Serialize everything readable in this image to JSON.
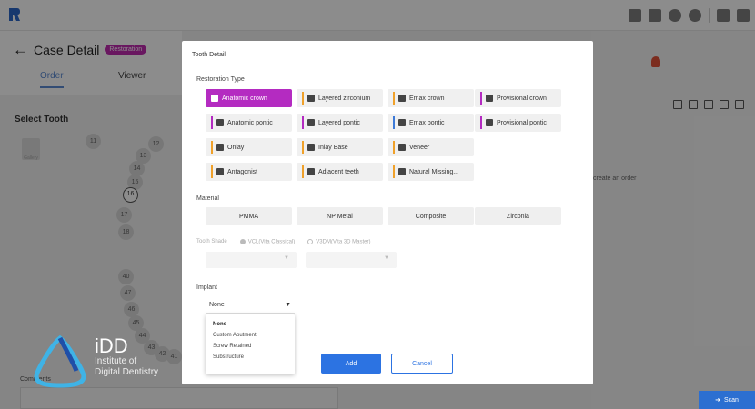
{
  "app": {
    "case_title": "Case Detail",
    "badge": "Restoration",
    "tabs": [
      "Order",
      "Viewer"
    ],
    "select_tooth": "Select Tooth",
    "gallery": "Gallery",
    "create_order_text": "create an order",
    "scan_label": "Scan",
    "comments_label": "Comments"
  },
  "teeth_upper": [
    "11",
    "12",
    "13",
    "14",
    "15",
    "16",
    "17",
    "18"
  ],
  "teeth_lower": [
    "40",
    "47",
    "46",
    "45",
    "44",
    "43",
    "42",
    "41"
  ],
  "watermark": {
    "big": "iDD",
    "line1": "Institute of",
    "line2": "Digital Dentistry"
  },
  "modal": {
    "title": "Tooth Detail",
    "restoration_label": "Restoration Type",
    "restoration_types": [
      "Anatomic crown",
      "Layered zirconium",
      "Emax crown",
      "Provisional crown",
      "Anatomic pontic",
      "Layered pontic",
      "Emax pontic",
      "Provisional pontic",
      "Onlay",
      "Inlay Base",
      "Veneer",
      "Antagonist",
      "Adjacent teeth",
      "Natural Missing..."
    ],
    "material_label": "Material",
    "materials": [
      "PMMA",
      "NP Metal",
      "Composite",
      "Zirconia"
    ],
    "shade_label": "Tooth Shade",
    "shade_options": [
      "VCL(Vita Classical)",
      "V3DM(Vita 3D Master)"
    ],
    "implant_label": "Implant",
    "implant_value": "None",
    "implant_options": [
      "None",
      "Custom Abutment",
      "Screw Retained",
      "Substructure"
    ],
    "add_label": "Add",
    "cancel_label": "Cancel"
  }
}
